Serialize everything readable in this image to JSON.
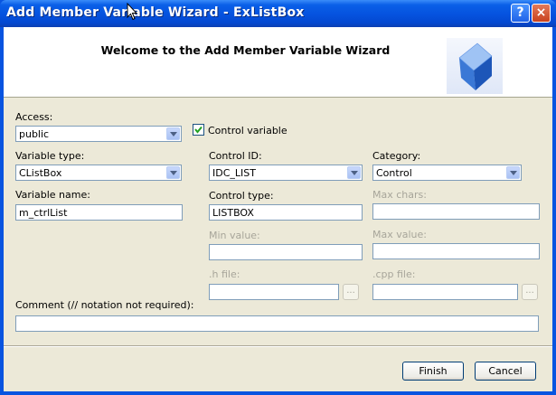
{
  "window": {
    "title": "Add Member Variable Wizard - ExListBox",
    "help_label": "?",
    "close_label": "×"
  },
  "header": {
    "title": "Welcome to the Add Member Variable Wizard"
  },
  "form": {
    "access": {
      "label": "Access:",
      "value": "public"
    },
    "control_variable": {
      "label": "Control variable",
      "checked": true
    },
    "variable_type": {
      "label": "Variable type:",
      "value": "CListBox"
    },
    "control_id": {
      "label": "Control ID:",
      "value": "IDC_LIST"
    },
    "category": {
      "label": "Category:",
      "value": "Control"
    },
    "variable_name": {
      "label": "Variable name:",
      "value": "m_ctrlList"
    },
    "control_type": {
      "label": "Control type:",
      "value": "LISTBOX"
    },
    "max_chars": {
      "label": "Max chars:",
      "value": ""
    },
    "min_value": {
      "label": "Min value:",
      "value": ""
    },
    "max_value": {
      "label": "Max value:",
      "value": ""
    },
    "h_file": {
      "label": ".h file:",
      "value": "",
      "browse_label": "..."
    },
    "cpp_file": {
      "label": ".cpp file:",
      "value": "",
      "browse_label": "..."
    },
    "comment": {
      "label": "Comment (// notation not required):",
      "value": ""
    }
  },
  "buttons": {
    "finish": "Finish",
    "cancel": "Cancel"
  },
  "colors": {
    "titlebar": "#0552de",
    "dialog_bg": "#ece9d8",
    "field_border": "#7f9db9",
    "disabled_text": "#a7a59a"
  }
}
